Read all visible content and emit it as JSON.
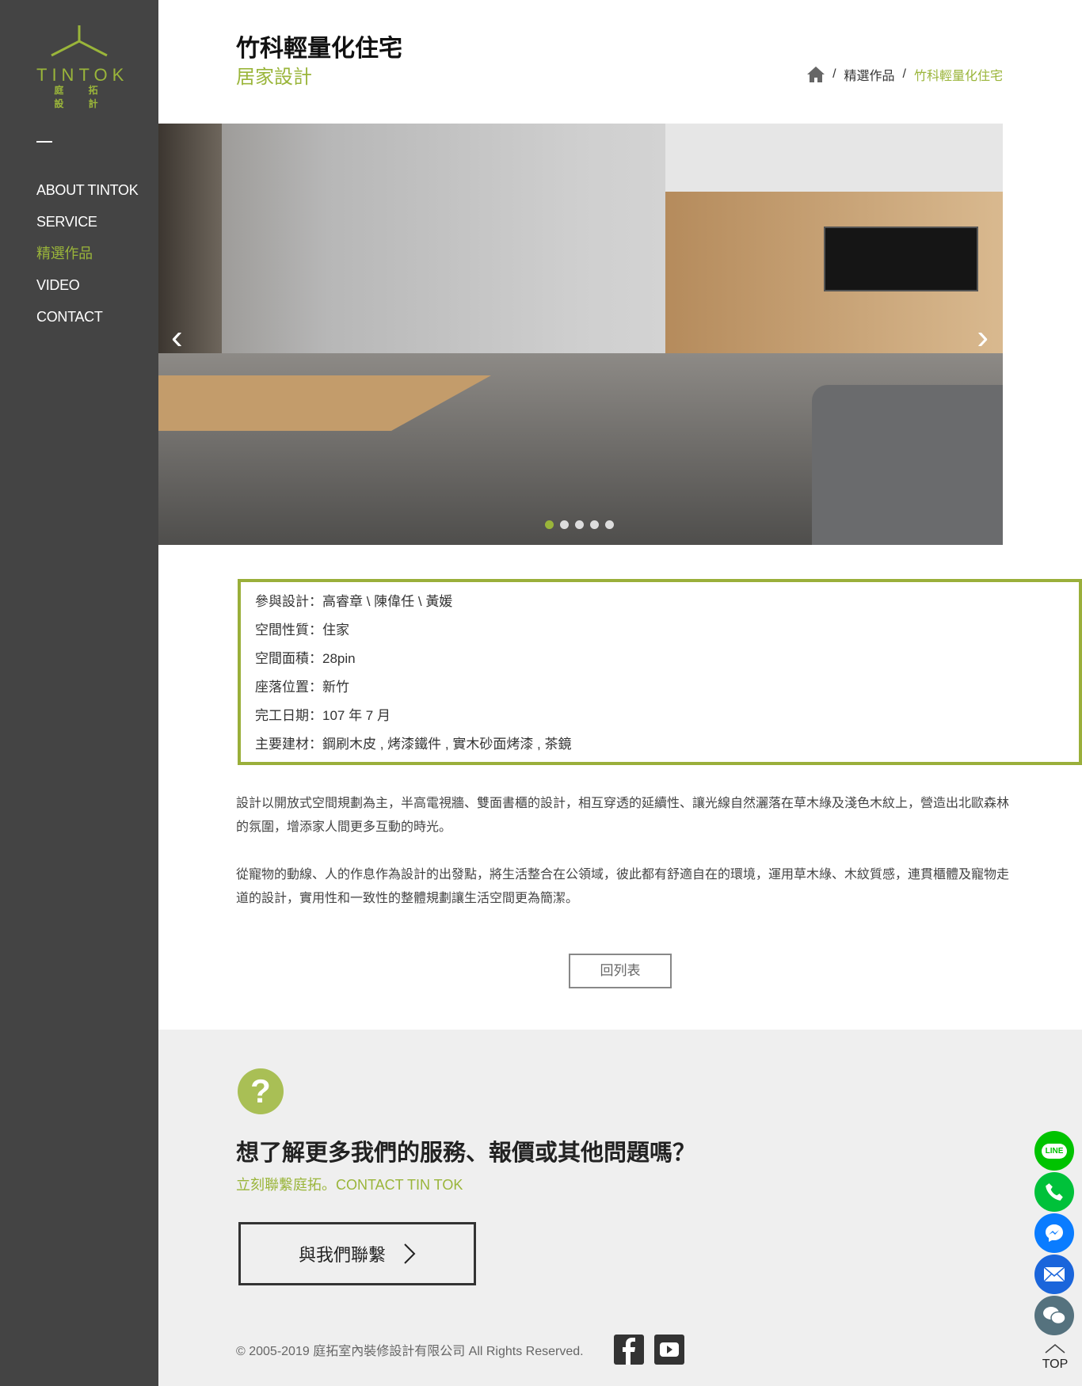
{
  "brand": {
    "name": "TINTOK",
    "name_cn": "庭 拓 設 計",
    "color": "#9ab53a"
  },
  "nav": [
    {
      "label": "ABOUT TINTOK"
    },
    {
      "label": "SERVICE"
    },
    {
      "label": "精選作品",
      "active": true
    },
    {
      "label": "VIDEO"
    },
    {
      "label": "CONTACT"
    }
  ],
  "header": {
    "title": "竹科輕量化住宅",
    "subtitle": "居家設計"
  },
  "breadcrumb": {
    "home_icon": "home-icon",
    "items": [
      "精選作品",
      "竹科輕量化住宅"
    ],
    "separator": "/"
  },
  "slider": {
    "total": 5,
    "current": 1,
    "prev": "‹",
    "next": "›"
  },
  "info": [
    "參與設計：高睿章 \\ 陳偉任 \\ 黃媛",
    "空間性質：住家",
    "空間面積：28pin",
    "座落位置：新竹",
    "完工日期：107 年 7 月",
    "主要建材：鋼刷木皮 , 烤漆鐵件 , 實木砂面烤漆 , 茶鏡"
  ],
  "description": [
    "設計以開放式空間規劃為主，半高電視牆、雙面書櫃的設計，相互穿透的延續性、讓光線自然灑落在草木綠及淺色木紋上，營造出北歐森林的氛圍，增添家人間更多互動的時光。",
    "從寵物的動線、人的作息作為設計的出發點，將生活整合在公領域，彼此都有舒適自在的環境，運用草木綠、木紋質感，連貫櫃體及寵物走道的設計，實用性和一致性的整體規劃讓生活空間更為簡潔。"
  ],
  "back_label": "回列表",
  "cta": {
    "heading": "想了解更多我們的服務、報價或其他問題嗎？",
    "sub": "立刻聯繫庭拓。CONTACT TIN TOK",
    "button": "與我們聯繫",
    "icon": "question-icon"
  },
  "footer": {
    "copyright": "© 2005-2019 庭拓室內裝修設計有限公司 All Rights Reserved.",
    "social": [
      "facebook-icon",
      "youtube-icon"
    ]
  },
  "floating": {
    "items": [
      {
        "icon": "line-icon",
        "label": "LINE",
        "color": "#00c300"
      },
      {
        "icon": "phone-icon",
        "color": "#00c13a"
      },
      {
        "icon": "messenger-icon",
        "color": "#0a7cff"
      },
      {
        "icon": "mail-icon",
        "color": "#1a65db"
      },
      {
        "icon": "wechat-icon",
        "color": "#55727e"
      }
    ],
    "top": "TOP"
  }
}
